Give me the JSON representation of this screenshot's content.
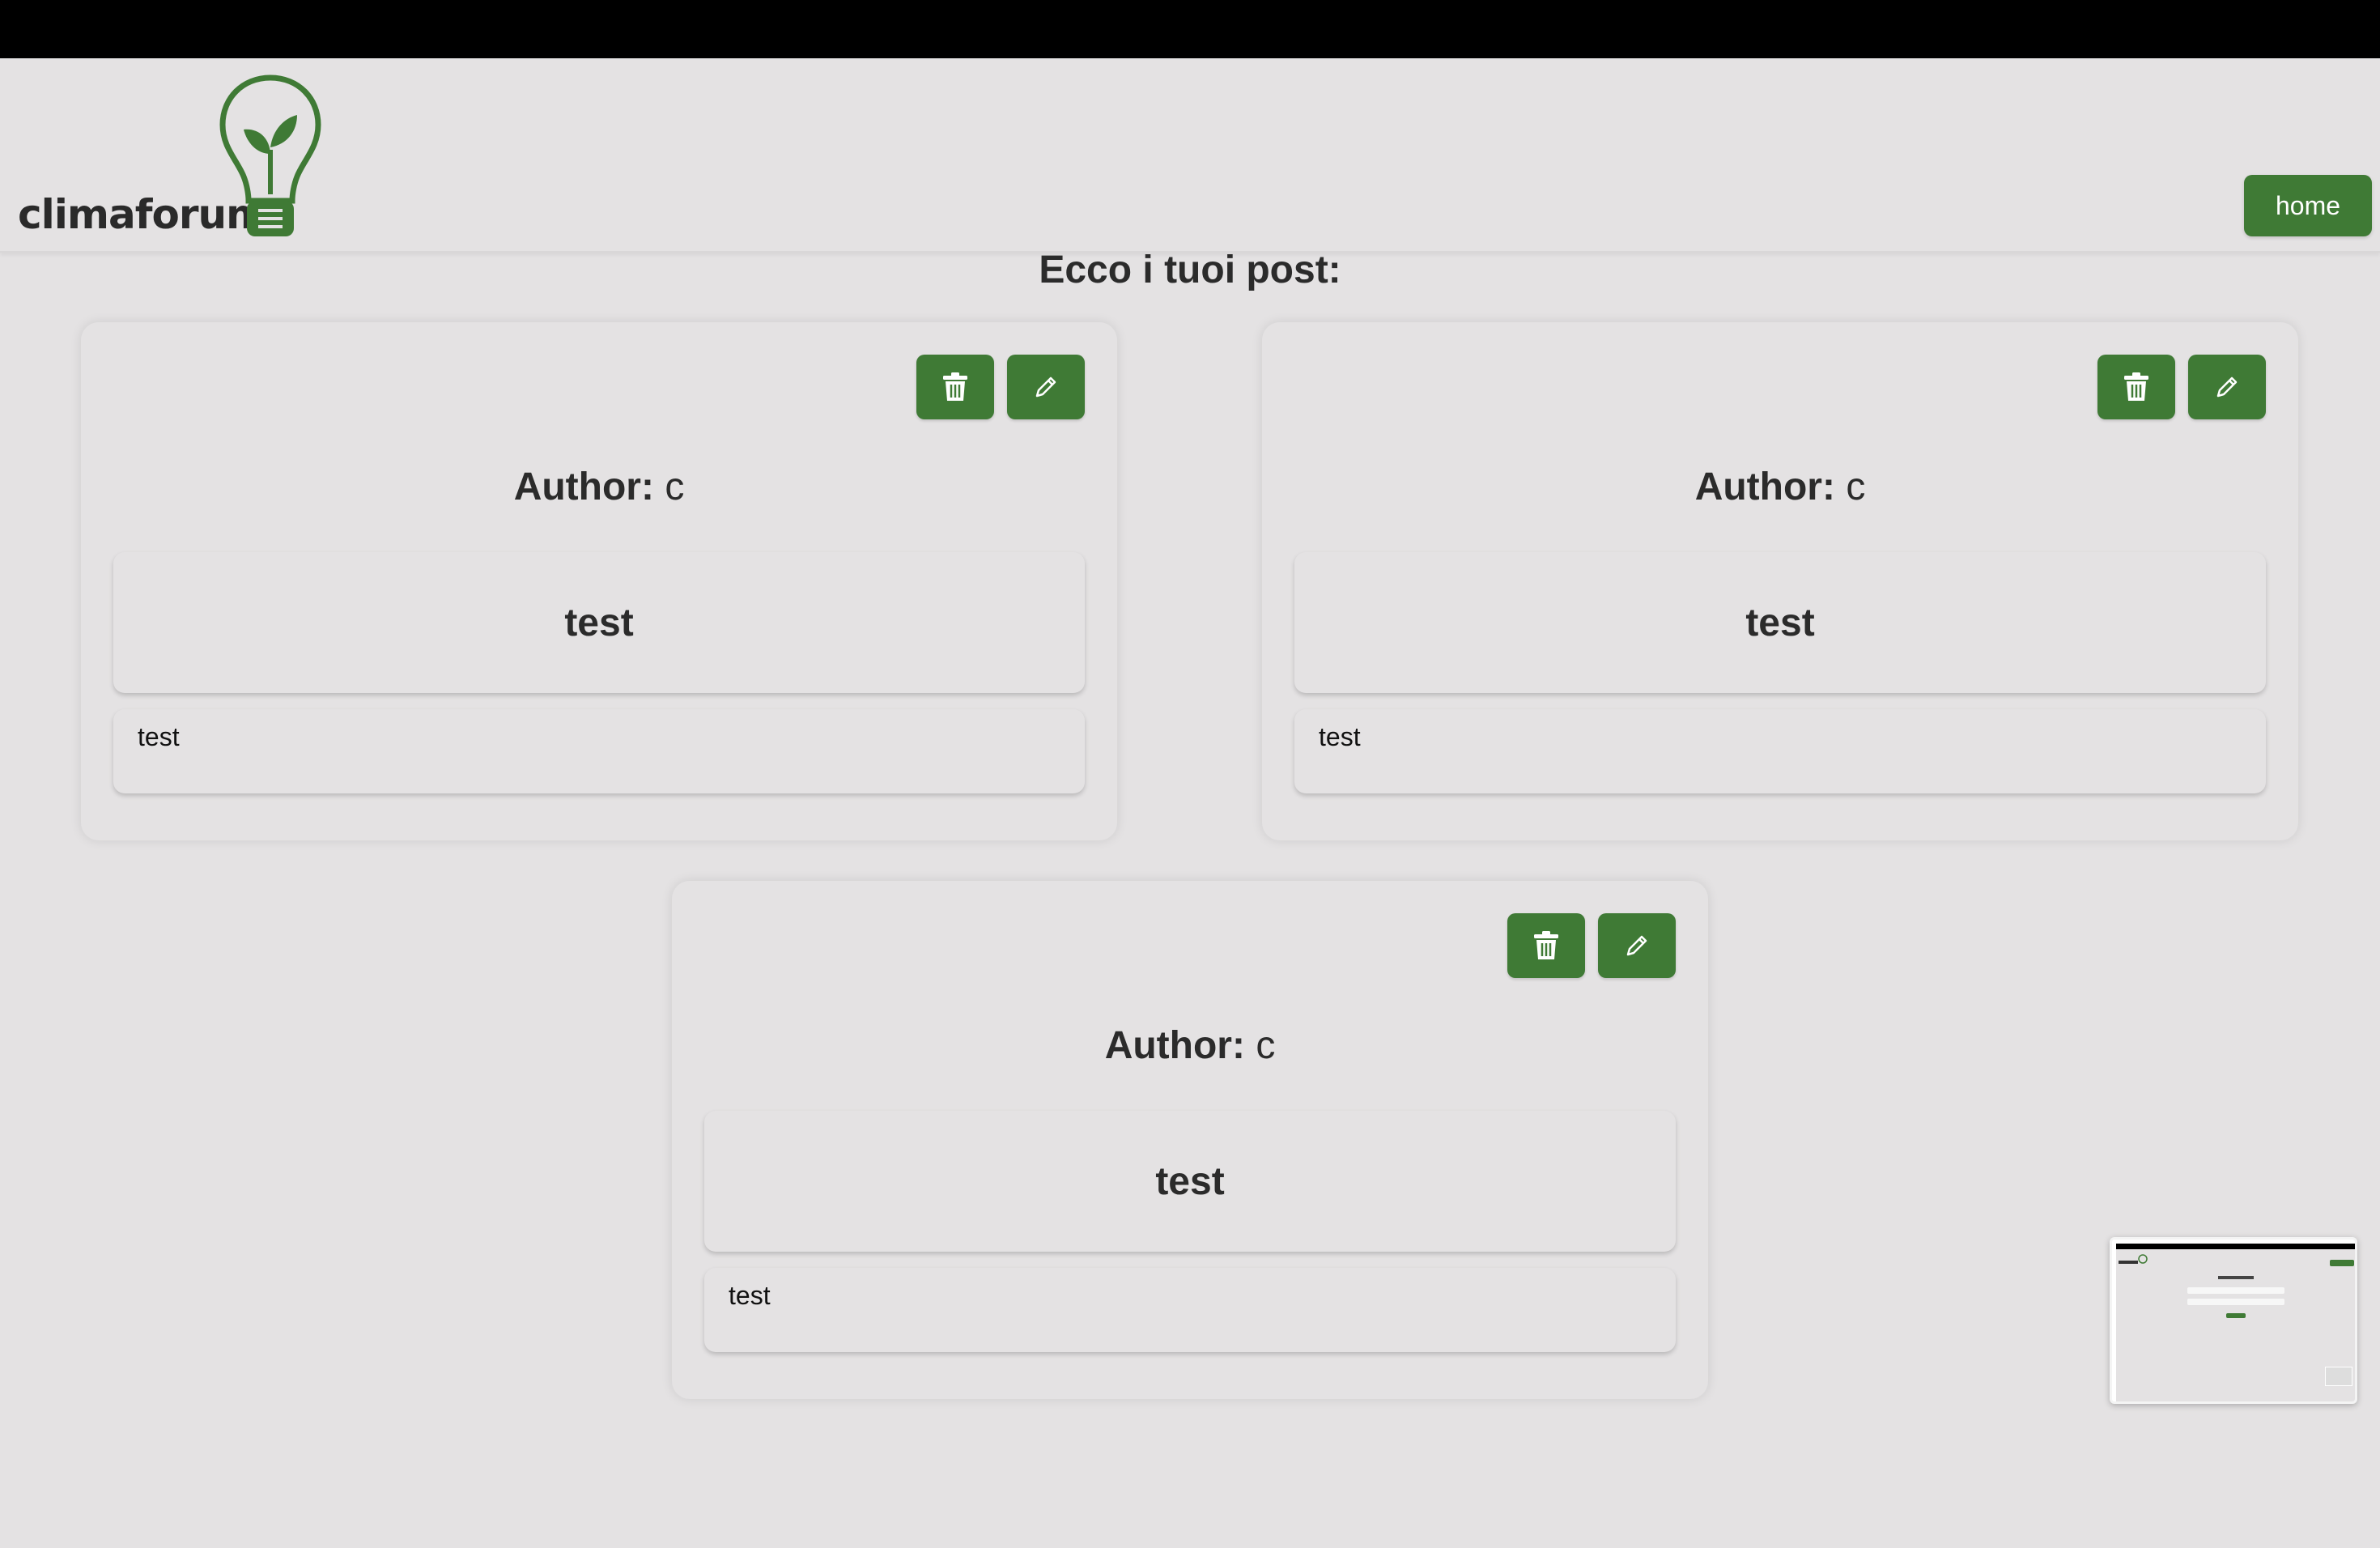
{
  "header": {
    "logo_text": "climaforum",
    "home_label": "home"
  },
  "page": {
    "title": "Ecco i tuoi post:"
  },
  "posts": [
    {
      "author_label": "Author:",
      "author": "c",
      "title": "test",
      "body": "test"
    },
    {
      "author_label": "Author:",
      "author": "c",
      "title": "test",
      "body": "test"
    },
    {
      "author_label": "Author:",
      "author": "c",
      "title": "test",
      "body": "test"
    }
  ],
  "icons": {
    "delete": "trash-icon",
    "edit": "pencil-icon"
  },
  "colors": {
    "accent": "#3f7a35",
    "background": "#e4e2e3",
    "text": "#2b2b2b"
  }
}
